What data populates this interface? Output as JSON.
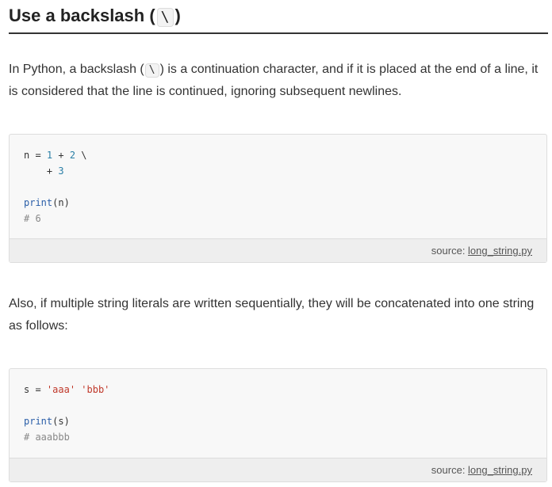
{
  "heading": {
    "text_before": "Use a backslash (",
    "code": "\\",
    "text_after": ")"
  },
  "paragraph1": {
    "text_before": "In Python, a backslash (",
    "code": "\\",
    "text_after": ") is a continuation character, and if it is placed at the end of a line, it is considered that the line is continued, ignoring subsequent newlines."
  },
  "code_block1": {
    "line1": {
      "var": "n",
      "op": " = ",
      "n1": "1",
      "plus": " + ",
      "n2": "2",
      "cont": " \\"
    },
    "line2": {
      "indent": "    + ",
      "n3": "3"
    },
    "line4": {
      "fn": "print",
      "args": "(n)"
    },
    "line5": "# 6",
    "source_label": "source: ",
    "source_file": "long_string.py"
  },
  "paragraph2": {
    "text": "Also, if multiple string literals are written sequentially, they will be concatenated into one string as follows:"
  },
  "code_block2": {
    "line1": {
      "var": "s",
      "op": " = ",
      "s1": "'aaa'",
      "space": " ",
      "s2": "'bbb'"
    },
    "line3": {
      "fn": "print",
      "args": "(s)"
    },
    "line4": "# aaabbb",
    "source_label": "source: ",
    "source_file": "long_string.py"
  },
  "colors": {
    "number": "#2a7fa6",
    "string": "#c0392b",
    "function": "#2a5ea8",
    "comment": "#888888",
    "code_bg": "#f8f8f8",
    "source_bar_bg": "#eeeeee"
  }
}
